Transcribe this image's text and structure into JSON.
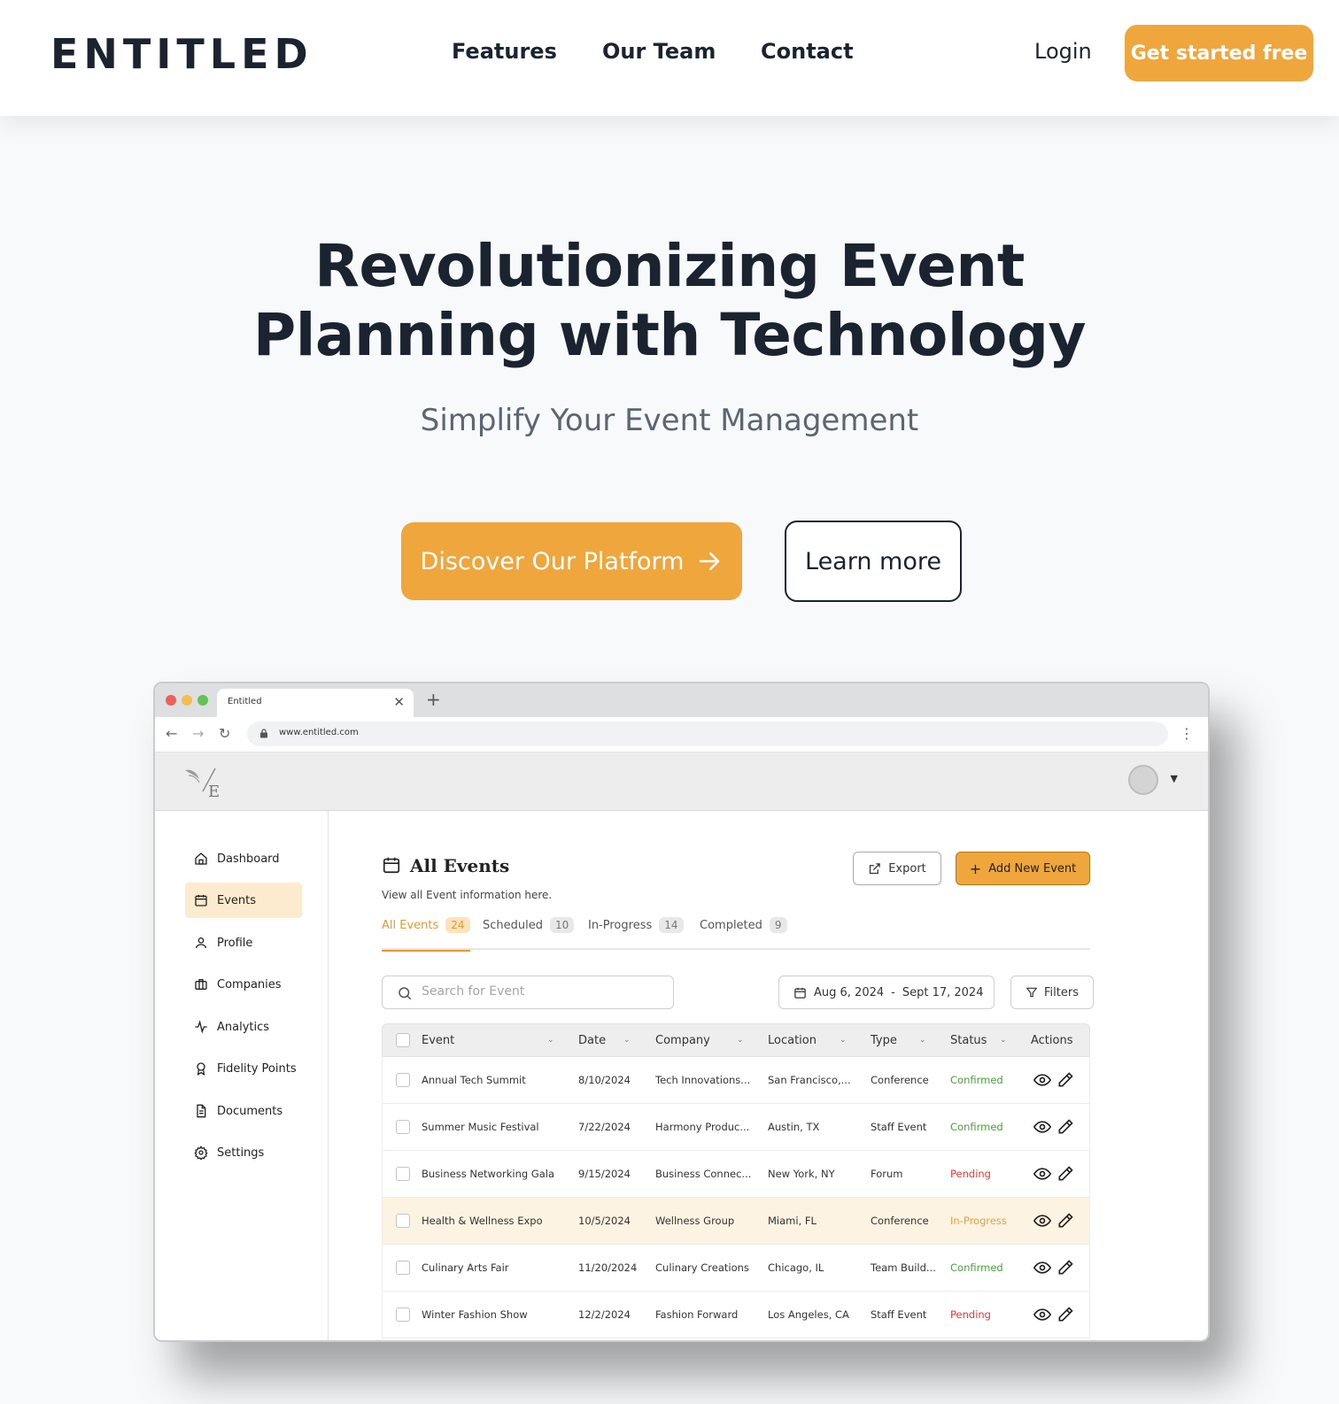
{
  "nav": {
    "logo": "ENTITLED",
    "links": [
      "Features",
      "Our Team",
      "Contact"
    ],
    "login": "Login",
    "cta": "Get started free"
  },
  "hero": {
    "title_line1": "Revolutionizing Event",
    "title_line2": "Planning with Technology",
    "subtitle": "Simplify Your Event Management",
    "primary_button": "Discover Our Platform",
    "secondary_button": "Learn more"
  },
  "browser": {
    "tab_title": "Entitled",
    "url": "www.entitled.com"
  },
  "app": {
    "sidebar": [
      {
        "label": "Dashboard",
        "icon": "home-icon",
        "active": false
      },
      {
        "label": "Events",
        "icon": "calendar-icon",
        "active": true
      },
      {
        "label": "Profile",
        "icon": "user-icon",
        "active": false
      },
      {
        "label": "Companies",
        "icon": "briefcase-icon",
        "active": false
      },
      {
        "label": "Analytics",
        "icon": "pulse-icon",
        "active": false
      },
      {
        "label": "Fidelity Points",
        "icon": "award-icon",
        "active": false
      },
      {
        "label": "Documents",
        "icon": "document-icon",
        "active": false
      },
      {
        "label": "Settings",
        "icon": "gear-icon",
        "active": false
      }
    ],
    "page_title": "All Events",
    "page_description": "View all Event information here.",
    "export_label": "Export",
    "add_label": "Add New Event",
    "tabs": [
      {
        "label": "All Events",
        "count": "24",
        "active": true
      },
      {
        "label": "Scheduled",
        "count": "10",
        "active": false
      },
      {
        "label": "In-Progress",
        "count": "14",
        "active": false
      },
      {
        "label": "Completed",
        "count": "9",
        "active": false
      }
    ],
    "search_placeholder": "Search for Event",
    "date_from": "Aug 6, 2024",
    "date_sep": "-",
    "date_to": "Sept 17, 2024",
    "filters_label": "Filters",
    "columns": [
      "Event",
      "Date",
      "Company",
      "Location",
      "Type",
      "Status",
      "Actions"
    ],
    "rows": [
      {
        "event": "Annual Tech Summit",
        "date": "8/10/2024",
        "company": "Tech Innovations...",
        "location": "San Francisco,...",
        "type": "Conference",
        "status": "Confirmed",
        "highlighted": false
      },
      {
        "event": "Summer Music Festival",
        "date": "7/22/2024",
        "company": "Harmony Produc...",
        "location": "Austin, TX",
        "type": "Staff Event",
        "status": "Confirmed",
        "highlighted": false
      },
      {
        "event": "Business Networking Gala",
        "date": "9/15/2024",
        "company": "Business Connec...",
        "location": "New York, NY",
        "type": "Forum",
        "status": "Pending",
        "highlighted": false
      },
      {
        "event": "Health & Wellness Expo",
        "date": "10/5/2024",
        "company": "Wellness Group",
        "location": "Miami, FL",
        "type": "Conference",
        "status": "In-Progress",
        "highlighted": true
      },
      {
        "event": "Culinary Arts Fair",
        "date": "11/20/2024",
        "company": "Culinary Creations",
        "location": "Chicago, IL",
        "type": "Team Build...",
        "status": "Confirmed",
        "highlighted": false
      },
      {
        "event": "Winter Fashion Show",
        "date": "12/2/2024",
        "company": "Fashion Forward",
        "location": "Los Angeles, CA",
        "type": "Staff Event",
        "status": "Pending",
        "highlighted": false
      }
    ]
  },
  "colors": {
    "accent": "#efa63d",
    "text_dark": "#1b2331",
    "confirmed": "#4aa13c",
    "pending": "#df3a3a",
    "in_progress": "#ef9f2e"
  }
}
